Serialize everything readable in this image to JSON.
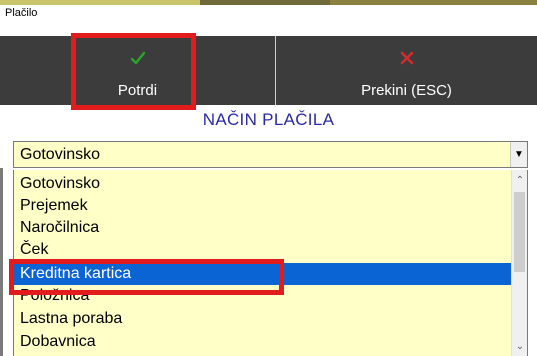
{
  "window": {
    "title": "Plačilo"
  },
  "toolbar": {
    "confirm": {
      "label": "Potrdi",
      "icon": "check-icon",
      "icon_color": "#2aa52a"
    },
    "cancel": {
      "label": "Prekini (ESC)",
      "icon": "x-icon",
      "icon_color": "#d42a2a"
    }
  },
  "section": {
    "title": "NAČIN PLAČILA"
  },
  "payment_select": {
    "value": "Gotovinsko",
    "options": [
      "Gotovinsko",
      "Prejemek",
      "Naročilnica",
      "Ček",
      "Kreditna kartica",
      "Položnica",
      "Lastna poraba",
      "Dobavnica"
    ],
    "selected_option": "Kreditna kartica"
  },
  "colors": {
    "toolbar_bg": "#3c3c3c",
    "field_bg": "#ffffc8",
    "selection": "#0a64d4",
    "title_blue": "#2a2aa8",
    "highlight_red": "#e21c1c"
  }
}
